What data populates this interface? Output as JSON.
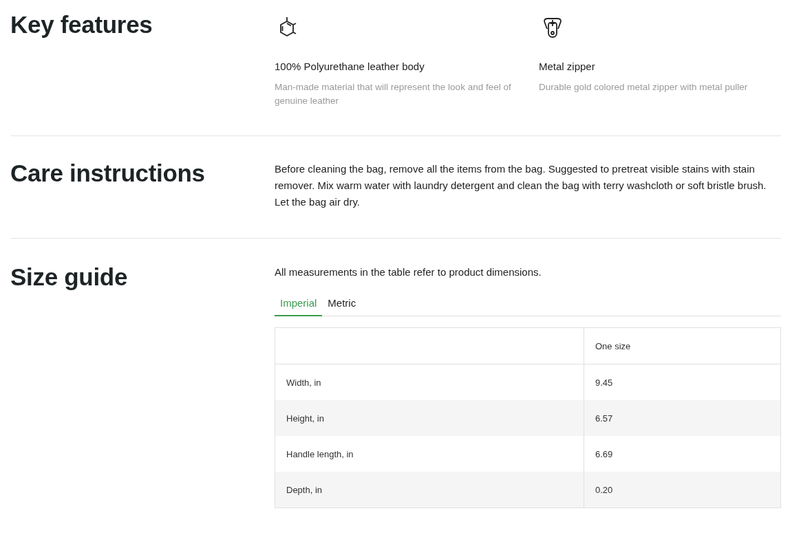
{
  "key_features": {
    "title": "Key features",
    "features": [
      {
        "kind": "material",
        "title": "100% Polyurethane leather body",
        "description": "Man-made material that will represent the look and feel of genuine leather"
      },
      {
        "kind": "zipper",
        "title": "Metal zipper",
        "description": "Durable gold colored metal zipper with metal puller"
      }
    ]
  },
  "care_instructions": {
    "title": "Care instructions",
    "text": "Before cleaning the bag, remove all the items from the bag. Suggested to pretreat visible stains with stain remover. Mix warm water with laundry detergent and clean the bag with terry washcloth or soft bristle brush. Let the bag air dry."
  },
  "size_guide": {
    "title": "Size guide",
    "note": "All measurements in the table refer to product dimensions.",
    "tabs": [
      {
        "label": "Imperial",
        "selected": true
      },
      {
        "label": "Metric",
        "selected": false
      }
    ],
    "table": {
      "columns": [
        "One size"
      ],
      "rows": [
        {
          "label": "Width, in",
          "value": "9.45"
        },
        {
          "label": "Height, in",
          "value": "6.57"
        },
        {
          "label": "Handle length, in",
          "value": "6.69"
        },
        {
          "label": "Depth, in",
          "value": "0.20"
        }
      ]
    }
  }
}
